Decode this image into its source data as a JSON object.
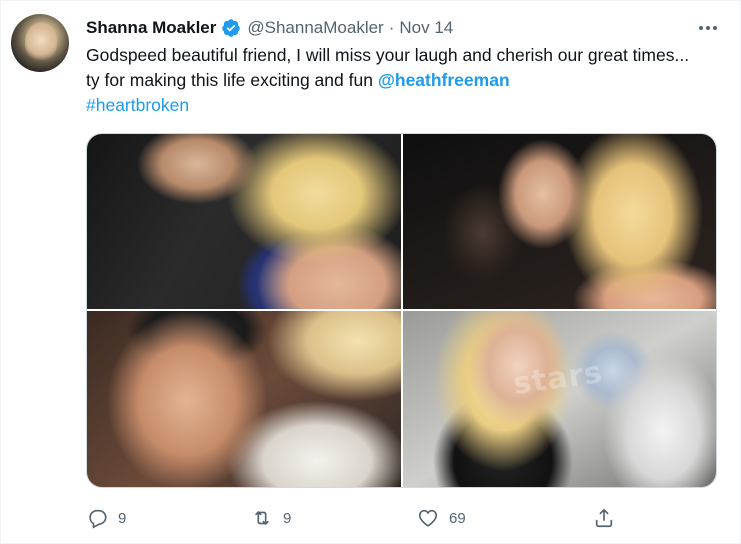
{
  "tweet": {
    "author_name": "Shanna Moakler",
    "handle": "@ShannaMoakler",
    "separator": "·",
    "date": "Nov 14",
    "text_part1": "Godspeed beautiful friend, I will miss your laugh and cherish our great times... ty for making this life exciting and fun ",
    "mention": "@heathfreeman",
    "hashtag": "#heartbroken",
    "media_watermark": "stars"
  },
  "actions": {
    "reply_count": "9",
    "retweet_count": "9",
    "like_count": "69"
  },
  "colors": {
    "link": "#1d9bf0",
    "verified": "#1d9bf0",
    "muted": "#536471",
    "text": "#0f1419"
  },
  "icons": {
    "verified": "verified-badge-icon",
    "more": "more-options-icon",
    "reply": "reply-icon",
    "retweet": "retweet-icon",
    "like": "heart-icon",
    "share": "share-icon"
  }
}
